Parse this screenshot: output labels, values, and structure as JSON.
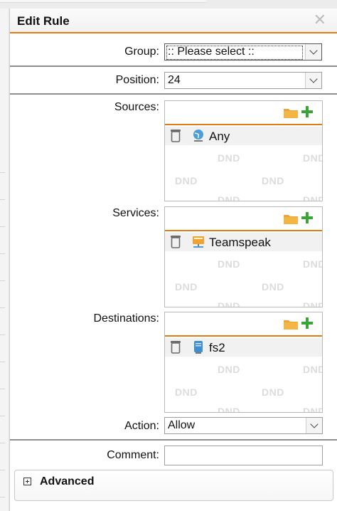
{
  "dialog": {
    "title": "Edit Rule",
    "close_icon": "close-x-icon"
  },
  "form": {
    "group": {
      "label": "Group:",
      "value": ":: Please select ::"
    },
    "position": {
      "label": "Position:",
      "value": "24"
    },
    "sources": {
      "label": "Sources:",
      "items": [
        {
          "name": "Any",
          "icon": "network-any-icon"
        }
      ]
    },
    "services": {
      "label": "Services:",
      "items": [
        {
          "name": "Teamspeak",
          "icon": "service-icon"
        }
      ]
    },
    "destinations": {
      "label": "Destinations:",
      "items": [
        {
          "name": "fs2",
          "icon": "host-icon"
        }
      ]
    },
    "dnd_watermark": "DND",
    "action": {
      "label": "Action:",
      "value": "Allow"
    },
    "comment": {
      "label": "Comment:",
      "value": ""
    }
  },
  "advanced": {
    "label": "Advanced"
  },
  "colors": {
    "accent": "#e07c14",
    "add_green": "#3aa537"
  }
}
